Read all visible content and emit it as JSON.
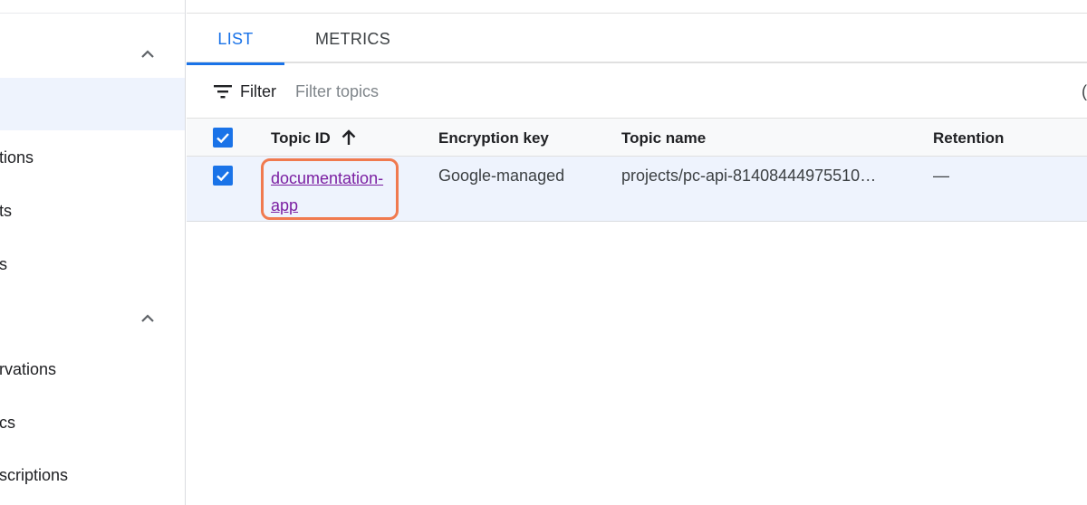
{
  "sidebar": {
    "items": [
      {
        "label": "tions"
      },
      {
        "label": "ts"
      },
      {
        "label": "s"
      },
      {
        "label": "rvations"
      },
      {
        "label": "cs"
      },
      {
        "label": "scriptions"
      }
    ]
  },
  "tabs": [
    {
      "label": "LIST",
      "selected": true
    },
    {
      "label": "METRICS",
      "selected": false
    }
  ],
  "filter": {
    "label": "Filter",
    "placeholder": "Filter topics",
    "extra": "("
  },
  "table": {
    "columns": [
      "Topic ID",
      "Encryption key",
      "Topic name",
      "Retention"
    ],
    "sort": {
      "column": "Topic ID",
      "direction": "ascending"
    },
    "rows": [
      {
        "topic_id_line1": "documentation-",
        "topic_id_line2": "app",
        "encryption_key": "Google-managed",
        "topic_name": "projects/pc-api-81408444975510…",
        "retention": "—",
        "checked": true
      }
    ]
  },
  "colors": {
    "accent": "#1a73e8",
    "link_visited": "#7b1fa2",
    "highlight_box": "#f07a4f",
    "selected_row": "#eef3fd"
  }
}
